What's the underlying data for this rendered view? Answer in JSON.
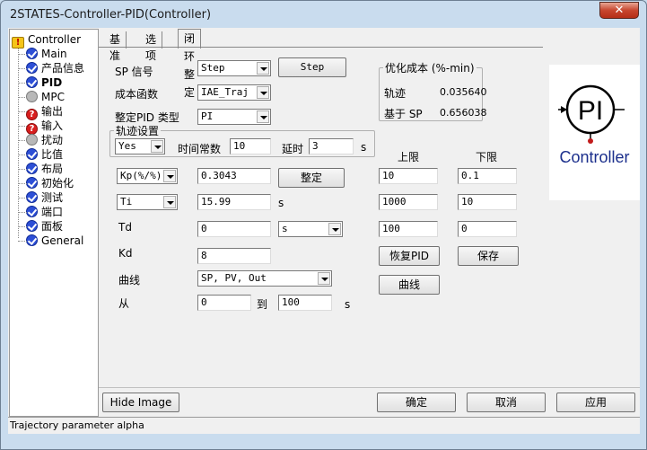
{
  "window": {
    "title": "2STATES-Controller-PID(Controller)",
    "close_glyph": "✕"
  },
  "tree": {
    "items": [
      {
        "label": "Controller",
        "icon": "folder-icon"
      },
      {
        "label": "Main",
        "icon": "check-icon"
      },
      {
        "label": "产品信息",
        "icon": "check-icon"
      },
      {
        "label": "PID",
        "icon": "check-icon"
      },
      {
        "label": "MPC",
        "icon": "gray-circle-icon"
      },
      {
        "label": "输出",
        "icon": "question-icon"
      },
      {
        "label": "输入",
        "icon": "question-icon"
      },
      {
        "label": "扰动",
        "icon": "gray-circle-icon"
      },
      {
        "label": "比值",
        "icon": "check-icon"
      },
      {
        "label": "布局",
        "icon": "check-icon"
      },
      {
        "label": "初始化",
        "icon": "check-icon"
      },
      {
        "label": "测试",
        "icon": "check-icon"
      },
      {
        "label": "端口",
        "icon": "check-icon"
      },
      {
        "label": "面板",
        "icon": "check-icon"
      },
      {
        "label": "General",
        "icon": "check-icon"
      }
    ]
  },
  "tabs": [
    "基准",
    "选项",
    "闭环整定"
  ],
  "form": {
    "sp_signal_label": "SP 信号",
    "sp_signal_value": "Step",
    "sp_signal_button": "Step",
    "cost_fn_label": "成本函数",
    "cost_fn_value": "IAE_Traj",
    "pid_type_label": "整定PID 类型",
    "pid_type_value": "PI",
    "traj_group_title": "轨迹设置",
    "traj_yes_value": "Yes",
    "time_const_label": "时间常数",
    "time_const_value": "10",
    "delay_label": "延时",
    "delay_value": "3",
    "delay_unit": "s",
    "kp_select": "Kp(%/%)",
    "kp_value": "0.3043",
    "tune_button": "整定",
    "ti_select": "Ti",
    "ti_value": "15.99",
    "ti_unit": "s",
    "td_label": "Td",
    "td_value": "0",
    "td_unit_select": "s",
    "kd_label": "Kd",
    "kd_value": "8",
    "curve_label": "曲线",
    "curve_value": "SP, PV, Out",
    "from_label": "从",
    "from_value": "0",
    "to_label": "到",
    "to_value": "100",
    "range_unit": "s"
  },
  "cost_group": {
    "title": "优化成本 (%-min)",
    "traj_label": "轨迹",
    "traj_value": "0.035640",
    "sp_label": "基于 SP",
    "sp_value": "0.656038"
  },
  "limits": {
    "upper_label": "上限",
    "lower_label": "下限",
    "rows": [
      {
        "upper": "10",
        "lower": "0.1"
      },
      {
        "upper": "1000",
        "lower": "10"
      },
      {
        "upper": "100",
        "lower": "0"
      }
    ],
    "restore_button": "恢复PID",
    "save_button": "保存",
    "curve_button": "曲线"
  },
  "logo": {
    "symbol": "PI",
    "text": "Controller"
  },
  "bottom": {
    "hide_image": "Hide Image",
    "ok": "确定",
    "cancel": "取消",
    "apply": "应用"
  },
  "status": "Trajectory parameter alpha"
}
